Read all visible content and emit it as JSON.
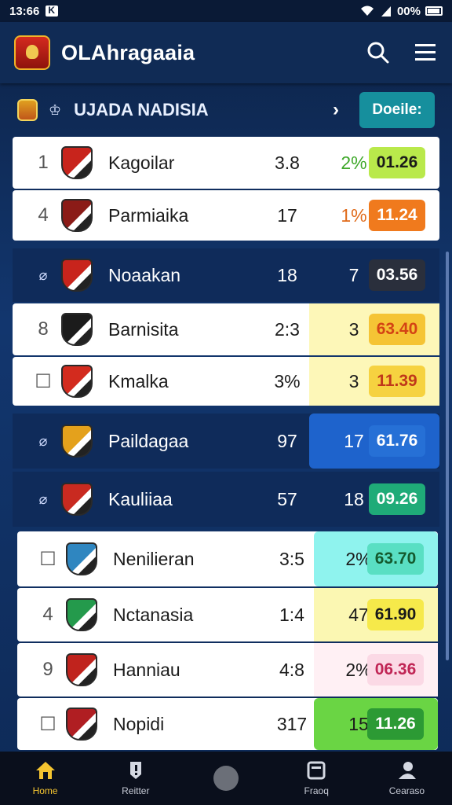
{
  "status_bar": {
    "time": "13:66",
    "battery": "00%"
  },
  "app_bar": {
    "title": "OLAhragaaia"
  },
  "league": {
    "name": "UJADA NADISIA",
    "details_label": "Doeile:"
  },
  "rows": [
    {
      "rank": "1",
      "name": "Kagoilar",
      "v1": "3.8",
      "v2": "2%",
      "pill": "01.26",
      "pill_color": "#b9e94b",
      "pill_text": "#1a1a1a",
      "style": "light",
      "badge_color": "#c8241c"
    },
    {
      "rank": "4",
      "name": "Parmiaika",
      "v1": "17",
      "v2": "1%",
      "pill": "11.24",
      "pill_color": "#f07a1d",
      "pill_text": "#ffffff",
      "style": "light",
      "badge_color": "#8b1b17"
    },
    {
      "rank": "",
      "name": "Noaakan",
      "v1": "18",
      "v2": "7",
      "pill": "03.56",
      "pill_color": "#2a2f3c",
      "pill_text": "#ffffff",
      "style": "dark",
      "badge_color": "#c8241c"
    },
    {
      "rank": "8",
      "name": "Barnisita",
      "v1": "2:3",
      "v2": "3",
      "pill": "63.40",
      "pill_color": "#f5c435",
      "pill_text": "#d44314",
      "style": "light",
      "badge_color": "#1b1b1b"
    },
    {
      "rank": "",
      "name": "Kmalka",
      "v1": "3%",
      "v2": "3",
      "pill": "11.39",
      "pill_color": "#f6d240",
      "pill_text": "#c0371a",
      "style": "light",
      "badge_color": "#d32b1e"
    },
    {
      "rank": "",
      "name": "Paildagaa",
      "v1": "97",
      "v2": "17",
      "pill": "61.76",
      "pill_color": "#2670d6",
      "pill_text": "#ffffff",
      "style": "dark",
      "badge_color": "#e4a11c"
    },
    {
      "rank": "",
      "name": "Kauliiaa",
      "v1": "57",
      "v2": "18",
      "pill": "09.26",
      "pill_color": "#1fab78",
      "pill_text": "#ffffff",
      "style": "dark",
      "badge_color": "#c92a20"
    },
    {
      "rank": "",
      "name": "Nenilieran",
      "v1": "3:5",
      "v2": "2%",
      "pill": "63.70",
      "pill_color": "#59dfc3",
      "pill_text": "#145a2e",
      "style": "light",
      "badge_color": "#2f86c0"
    },
    {
      "rank": "4",
      "name": "Nctanasia",
      "v1": "1:4",
      "v2": "47",
      "pill": "61.90",
      "pill_color": "#f6e94a",
      "pill_text": "#1a1a1a",
      "style": "light",
      "badge_color": "#249a4c"
    },
    {
      "rank": "9",
      "name": "Hanniau",
      "v1": "4:8",
      "v2": "2%",
      "pill": "06.36",
      "pill_color": "#fbd9e5",
      "pill_text": "#c02555",
      "style": "light",
      "badge_color": "#c0231d"
    },
    {
      "rank": "",
      "name": "Nopidi",
      "v1": "317",
      "v2": "15",
      "pill": "11.26",
      "pill_color": "#2c9a34",
      "pill_text": "#ffffff",
      "style": "light",
      "badge_color": "#b01e22"
    }
  ],
  "bottom_nav": [
    {
      "label": "Home",
      "icon": "home-icon",
      "active": true
    },
    {
      "label": "Reitter",
      "icon": "alert-icon",
      "active": false
    },
    {
      "label": "",
      "icon": "center-button-icon",
      "active": false
    },
    {
      "label": "Fraoq",
      "icon": "fixtures-icon",
      "active": false
    },
    {
      "label": "Cearaso",
      "icon": "profile-icon",
      "active": false
    }
  ],
  "colors": {
    "accent": "#f4c430",
    "brand": "#102b55",
    "details": "#168f9d"
  }
}
